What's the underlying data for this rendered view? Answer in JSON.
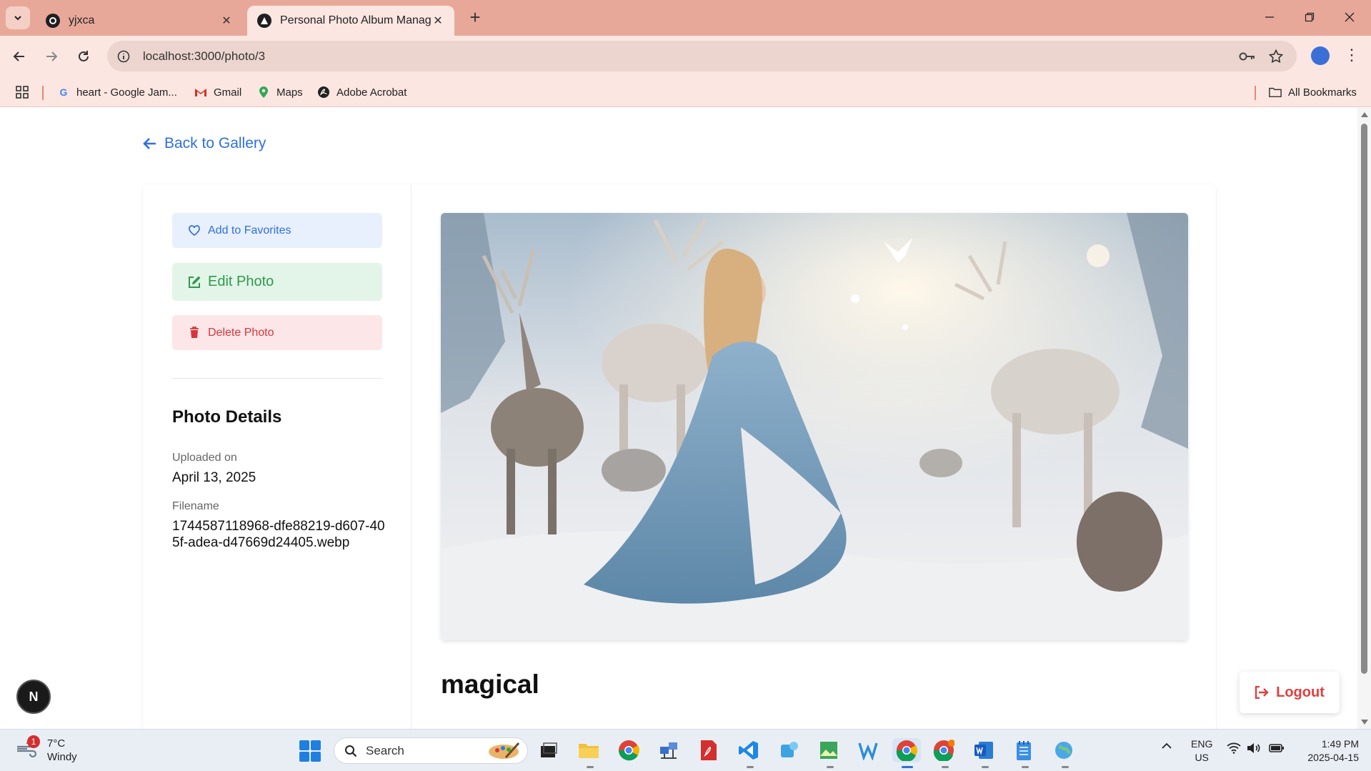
{
  "browser": {
    "tabs": [
      {
        "title": "yjxca",
        "icon": "github-icon",
        "active": false
      },
      {
        "title": "Personal Photo Album Manager",
        "icon": "app-icon",
        "active": true
      }
    ],
    "url": "localhost:3000/photo/3",
    "bookmarks": [
      {
        "label": "heart - Google Jam...",
        "icon": "google-icon"
      },
      {
        "label": "Gmail",
        "icon": "gmail-icon"
      },
      {
        "label": "Maps",
        "icon": "maps-icon"
      },
      {
        "label": "Adobe Acrobat",
        "icon": "acrobat-icon"
      }
    ],
    "all_bookmarks": "All Bookmarks"
  },
  "page": {
    "back_link": "Back to Gallery",
    "actions": {
      "favorite": "Add to Favorites",
      "edit": "Edit Photo",
      "delete": "Delete Photo"
    },
    "details": {
      "title": "Photo Details",
      "uploaded_label": "Uploaded on",
      "uploaded_value": "April 13, 2025",
      "filename_label": "Filename",
      "filename_value": "1744587118968-dfe88219-d607-405f-adea-d47669d24405.webp"
    },
    "photo": {
      "title": "magical",
      "alt": "magical"
    },
    "logout": "Logout",
    "dev_badge": "N",
    "colors": {
      "link": "#2f6fe0",
      "favorite_bg": "#e8f0fd",
      "edit": "#2e9a4b",
      "edit_bg": "#e3f5e8",
      "delete": "#d3373d",
      "delete_bg": "#fce6e8",
      "logout": "#e0403f"
    }
  },
  "taskbar": {
    "weather": {
      "temp": "7°C",
      "condition": "Windy",
      "badge": "1"
    },
    "search_placeholder": "Search",
    "language": {
      "line1": "ENG",
      "line2": "US"
    },
    "time": "1:49 PM",
    "date": "2025-04-15"
  }
}
